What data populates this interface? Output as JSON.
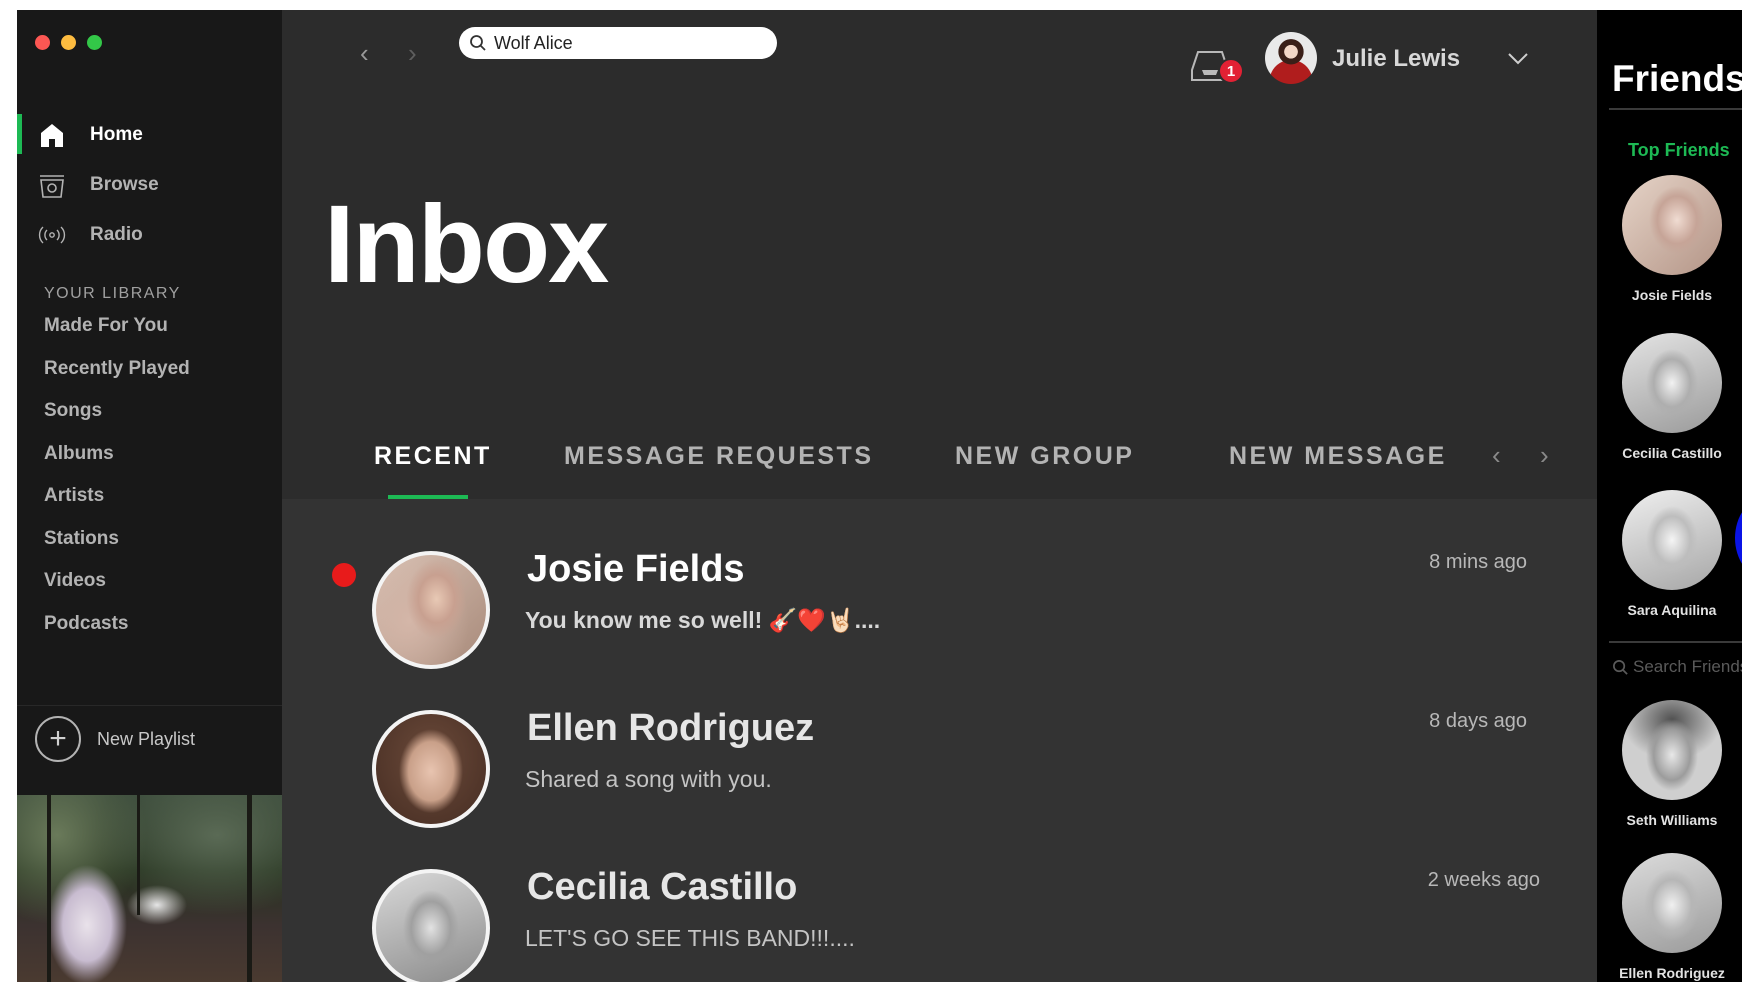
{
  "sidebar": {
    "nav": [
      {
        "label": "Home",
        "icon": "home-icon",
        "active": true
      },
      {
        "label": "Browse",
        "icon": "browse-icon",
        "active": false
      },
      {
        "label": "Radio",
        "icon": "radio-icon",
        "active": false
      }
    ],
    "library_title": "YOUR LIBRARY",
    "library": [
      "Made For You",
      "Recently Played",
      "Songs",
      "Albums",
      "Artists",
      "Stations",
      "Videos",
      "Podcasts"
    ],
    "new_playlist": "New Playlist"
  },
  "topbar": {
    "search_value": "Wolf Alice",
    "notification_count": "1",
    "user_name": "Julie Lewis"
  },
  "main": {
    "title": "Inbox",
    "tabs": [
      {
        "label": "RECENT",
        "active": true
      },
      {
        "label": "MESSAGE REQUESTS",
        "active": false
      },
      {
        "label": "NEW GROUP",
        "active": false
      },
      {
        "label": "NEW MESSAGE",
        "active": false
      }
    ],
    "messages": [
      {
        "name": "Josie Fields",
        "preview": "You know me so well! 🎸❤️🤘🏻....",
        "time": "8 mins ago",
        "unread": true
      },
      {
        "name": "Ellen Rodriguez",
        "preview": "Shared a song with you.",
        "time": "8 days ago",
        "unread": false
      },
      {
        "name": "Cecilia Castillo",
        "preview": "LET'S GO SEE THIS BAND!!!....",
        "time": "2 weeks ago",
        "unread": false
      }
    ]
  },
  "friends": {
    "title": "Friends",
    "top_label": "Top Friends",
    "top": [
      "Josie Fields",
      "Cecilia Castillo",
      "Sara Aquilina"
    ],
    "search_placeholder": "Search Friends",
    "others": [
      "Seth Williams",
      "Ellen Rodriguez"
    ]
  },
  "colors": {
    "accent": "#1db954",
    "unread": "#e81b1b",
    "badge": "#e22134"
  }
}
